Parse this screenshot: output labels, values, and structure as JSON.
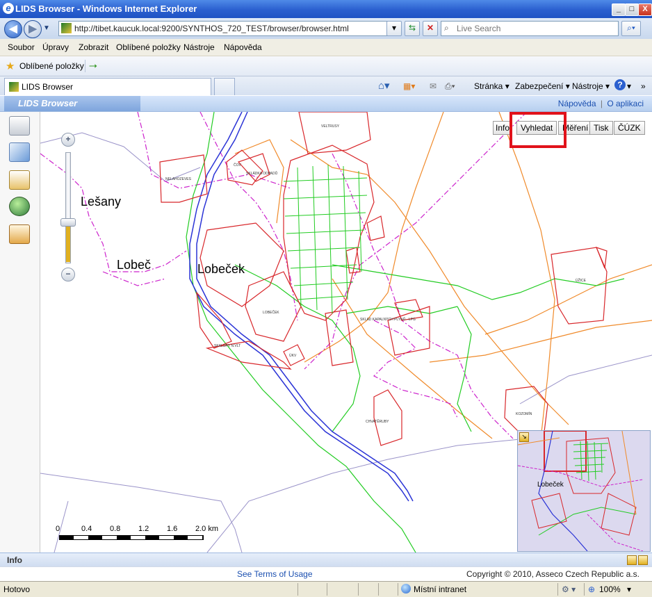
{
  "window": {
    "title": "LIDS Browser - Windows Internet Explorer",
    "controls": {
      "minimize": "_",
      "maximize": "□",
      "close": "X"
    }
  },
  "address_bar": {
    "url": "http://tibet.kaucuk.local:9200/SYNTHOS_720_TEST/browser/browser.html",
    "search_placeholder": "Live Search"
  },
  "menu": [
    "Soubor",
    "Úpravy",
    "Zobrazit",
    "Oblíbené položky",
    "Nástroje",
    "Nápověda"
  ],
  "favorites": {
    "label": "Oblíbené položky"
  },
  "tabs": [
    {
      "label": "LIDS Browser"
    }
  ],
  "command_bar": [
    "Stránka",
    "Zabezpečení",
    "Nástroje"
  ],
  "app": {
    "brand": "LIDS Browser",
    "help_link": "Nápověda",
    "about_link": "O aplikaci",
    "separator": "|"
  },
  "map_buttons": [
    "Info",
    "Vyhledat",
    "Měření",
    "Tisk",
    "ČÚZK"
  ],
  "place_names": [
    "Lešany",
    "Lobeč",
    "Lobeček"
  ],
  "map_labels": [
    "VELTRUSY",
    "NELAHOZEVES",
    "ČOV",
    "SKLÁDKA ODPADŮ",
    "LOBEČEK",
    "SKALUPY N.VLT",
    "ÚKV",
    "SKLAD KAPALNÝCH PLYNŮ - LPG",
    "CHVATĚRUBY",
    "KOZOMÍN",
    "ÚŽICE"
  ],
  "scale_bar": {
    "ticks": [
      "0",
      "0.4",
      "0.8",
      "1.2",
      "1.6",
      "2.0 km"
    ]
  },
  "overview": {
    "label": "Lobeček"
  },
  "info_panel": {
    "title": "Info"
  },
  "footer": {
    "terms": "See Terms of Usage",
    "copyright": "Copyright © 2010, Asseco Czech Republic a.s."
  },
  "status": {
    "text": "Hotovo",
    "zone": "Místní intranet",
    "zoom": "100%"
  },
  "colors": {
    "highlight": "#e1121b",
    "parcel": "#d8262a",
    "grid": "#22cc22",
    "river": "#2a33d6",
    "road": "#f08a2a",
    "boundary": "#cc22cc"
  }
}
